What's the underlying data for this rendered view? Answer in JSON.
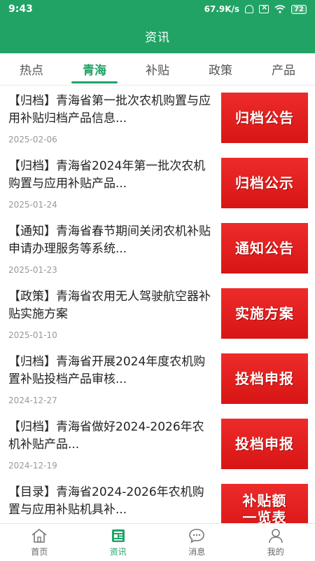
{
  "status": {
    "time": "9:43",
    "speed": "67.9K/s",
    "battery": "72"
  },
  "header": {
    "title": "资讯"
  },
  "tabs": [
    {
      "label": "热点"
    },
    {
      "label": "青海"
    },
    {
      "label": "补贴"
    },
    {
      "label": "政策"
    },
    {
      "label": "产品"
    }
  ],
  "active_tab": "青海",
  "articles": [
    {
      "title": "【归档】青海省第一批次农机购置与应用补贴归档产品信息...",
      "date": "2025-02-06",
      "thumb": "归档公告"
    },
    {
      "title": "【归档】青海省2024年第一批次农机购置与应用补贴产品...",
      "date": "2025-01-24",
      "thumb": "归档公示"
    },
    {
      "title": "【通知】青海省春节期间关闭农机补贴申请办理服务等系统...",
      "date": "2025-01-23",
      "thumb": "通知公告"
    },
    {
      "title": "【政策】青海省农用无人驾驶航空器补贴实施方案",
      "date": "2025-01-10",
      "thumb": "实施方案"
    },
    {
      "title": "【归档】青海省开展2024年度农机购置补贴投档产品审核...",
      "date": "2024-12-27",
      "thumb": "投档申报"
    },
    {
      "title": "【归档】青海省做好2024-2026年农机补贴产品...",
      "date": "2024-12-19",
      "thumb": "投档申报"
    },
    {
      "title": "【目录】青海省2024-2026年农机购置与应用补贴机具补...",
      "date": "",
      "thumb": "补贴额\n一览表"
    }
  ],
  "bottom_nav": [
    {
      "label": "首页",
      "icon": "home-icon"
    },
    {
      "label": "资讯",
      "icon": "news-icon"
    },
    {
      "label": "消息",
      "icon": "message-icon"
    },
    {
      "label": "我的",
      "icon": "profile-icon"
    }
  ],
  "colors": {
    "brand": "#21a366",
    "thumb_red": "#e02020"
  }
}
